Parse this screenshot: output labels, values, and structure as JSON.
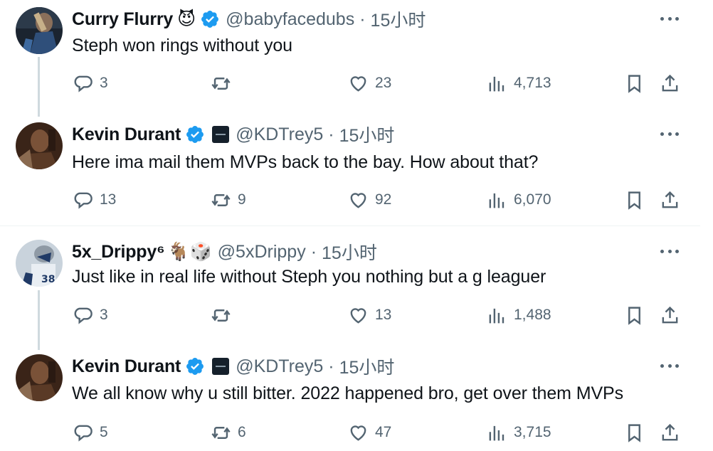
{
  "tweets": [
    {
      "name": "Curry Flurry",
      "name_emoji": "😈",
      "verified": true,
      "affiliation": false,
      "handle": "@babyfacedubs",
      "separator": "·",
      "time": "15小时",
      "text": "Steph won rings without you",
      "replies": "3",
      "retweets": "",
      "likes": "23",
      "views": "4,713"
    },
    {
      "name": "Kevin Durant",
      "name_emoji": "",
      "verified": true,
      "affiliation": true,
      "handle": "@KDTrey5",
      "separator": "·",
      "time": "15小时",
      "text": "Here ima mail them MVPs back to the bay. How about that?",
      "replies": "13",
      "retweets": "9",
      "likes": "92",
      "views": "6,070"
    },
    {
      "name": "5x_Drippy⁶",
      "name_emoji": "🐐🎲",
      "verified": false,
      "affiliation": false,
      "handle": "@5xDrippy",
      "separator": "·",
      "time": "15小时",
      "text": "Just like in real life without Steph you nothing but a g leaguer",
      "replies": "3",
      "retweets": "",
      "likes": "13",
      "views": "1,488"
    },
    {
      "name": "Kevin Durant",
      "name_emoji": "",
      "verified": true,
      "affiliation": true,
      "handle": "@KDTrey5",
      "separator": "·",
      "time": "15小时",
      "text": "We all know why u still bitter. 2022 happened bro, get over them MVPs",
      "replies": "5",
      "retweets": "6",
      "likes": "47",
      "views": "3,715"
    }
  ],
  "colors": {
    "text": "#0f1419",
    "secondary": "#536471",
    "verified": "#1d9bf0",
    "thread_line": "#cfd9de",
    "divider": "#eff3f4"
  }
}
